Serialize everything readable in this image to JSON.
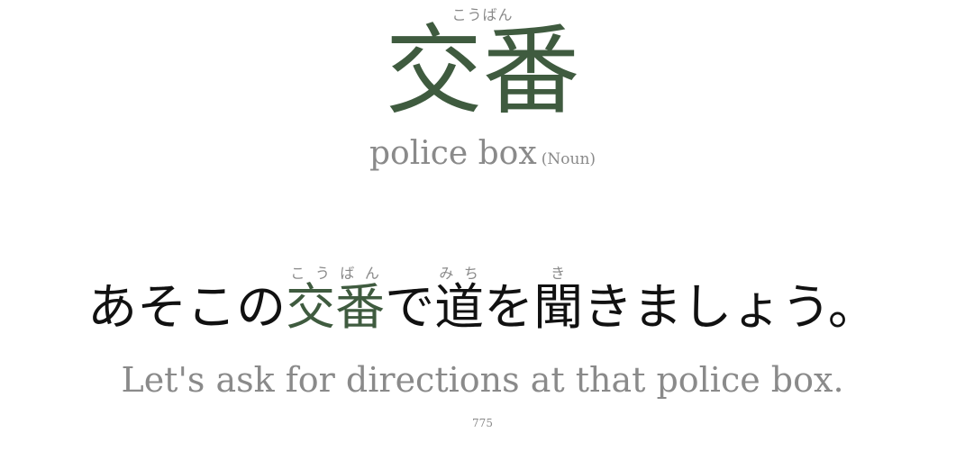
{
  "headword": {
    "reading": "こうばん",
    "kanji": "交番",
    "meaning": "police box",
    "part_of_speech": "(Noun)"
  },
  "sentence": {
    "segments": [
      {
        "text": "あそこの",
        "reading": ""
      },
      {
        "text": "交番",
        "reading": "こうばん"
      },
      {
        "text": "で",
        "reading": ""
      },
      {
        "text": "道",
        "reading": "みち"
      },
      {
        "text": "を",
        "reading": ""
      },
      {
        "text": "聞",
        "reading": "き"
      },
      {
        "text": "きましょう。",
        "reading": ""
      }
    ]
  },
  "translation": "Let's ask for directions at that police box.",
  "card_number": "775",
  "colors": {
    "accent": "#3f5b3f",
    "muted": "#8a8a8a",
    "text": "#111111"
  }
}
